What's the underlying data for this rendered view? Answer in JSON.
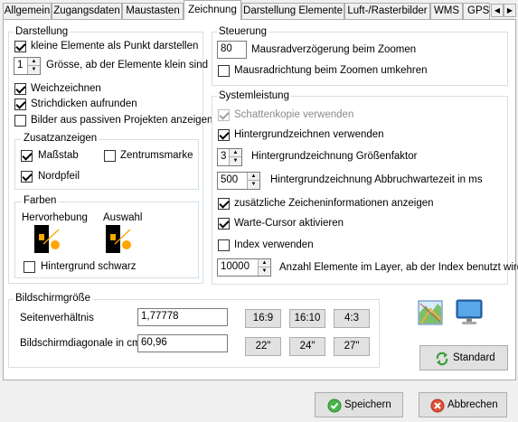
{
  "tabs": [
    "Allgemein",
    "Zugangsdaten",
    "Maustasten",
    "Zeichnung",
    "Darstellung Elemente",
    "Luft-/Rasterbilder",
    "WMS",
    "GPS"
  ],
  "active_tab": "Zeichnung",
  "darstellung": {
    "title": "Darstellung",
    "kleine_elemente": "kleine Elemente als Punkt darstellen",
    "groesse_value": "1",
    "groesse_label": "Grösse, ab der Elemente klein sind",
    "weichzeichnen": "Weichzeichnen",
    "strichdicken": "Strichdicken aufrunden",
    "bilder_passiv": "Bilder aus passiven Projekten anzeigen"
  },
  "zusatzanzeigen": {
    "title": "Zusatzanzeigen",
    "massstab": "Maßstab",
    "zentrumsmarke": "Zentrumsmarke",
    "nordpfeil": "Nordpfeil"
  },
  "farben": {
    "title": "Farben",
    "hervorhebung": "Hervorhebung",
    "auswahl": "Auswahl",
    "hintergrund_schwarz": "Hintergrund schwarz",
    "colors": {
      "swatch_bg": "#000000",
      "swatch_fg": "#ffa500"
    }
  },
  "steuerung": {
    "title": "Steuerung",
    "mausrad_value": "80",
    "mausrad_label": "Mausradverzögerung beim Zoomen",
    "mausrichtung": "Mausradrichtung beim Zoomen umkehren"
  },
  "systemleistung": {
    "title": "Systemleistung",
    "schattenkopie": "Schattenkopie verwenden",
    "hintergrundzeichnen": "Hintergrundzeichnen verwenden",
    "faktor_value": "3",
    "faktor_label": "Hintergrundzeichnung Größenfaktor",
    "abbruch_value": "500",
    "abbruch_label": "Hintergrundzeichnung Abbruchwartezeit in ms",
    "zusaetzliche": "zusätzliche Zeicheninformationen anzeigen",
    "warte_cursor": "Warte-Cursor aktivieren",
    "index": "Index verwenden",
    "anzahl_value": "10000",
    "anzahl_label": "Anzahl Elemente im Layer, ab der Index benutzt wird"
  },
  "bildschirm": {
    "title": "Bildschirmgröße",
    "seitenverhaeltnis_label": "Seitenverhältnis",
    "seitenverhaeltnis_value": "1,77778",
    "diagonale_label": "Bildschirmdiagonale in cm",
    "diagonale_value": "60,96",
    "ratio_buttons": [
      "16:9",
      "16:10",
      "4:3"
    ],
    "size_buttons": [
      "22\"",
      "24\"",
      "27\""
    ]
  },
  "standard_button": "Standard",
  "speichern_button": "Speichern",
  "abbrechen_button": "Abbrechen"
}
